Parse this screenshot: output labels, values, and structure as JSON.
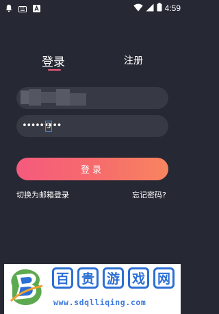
{
  "status_bar": {
    "time": "4:59",
    "left_icons": [
      "notification-bell-icon",
      "keyboard-icon",
      "a-app-icon"
    ],
    "right_icons": [
      "wifi-icon",
      "cellular-signal-icon",
      "battery-icon"
    ]
  },
  "tabs": {
    "login": "登录",
    "register": "注册",
    "active": "login"
  },
  "form": {
    "password_masked": "•••••••••",
    "password_last_char": "3"
  },
  "login_button": {
    "label": "登录"
  },
  "links": {
    "switch_email": "切换为邮箱登录",
    "forgot_password": "忘记密码?"
  },
  "watermark": {
    "title_chars": [
      "百",
      "贵",
      "游",
      "戏",
      "网"
    ],
    "url": "www.sdqlliqing.com"
  },
  "colors": {
    "background": "#262833",
    "field": "#373a45",
    "accent": "#f3587a",
    "button_gradient_start": "#f55a7d",
    "button_gradient_end": "#f8855f",
    "watermark_blue": "#2c6fd4"
  }
}
